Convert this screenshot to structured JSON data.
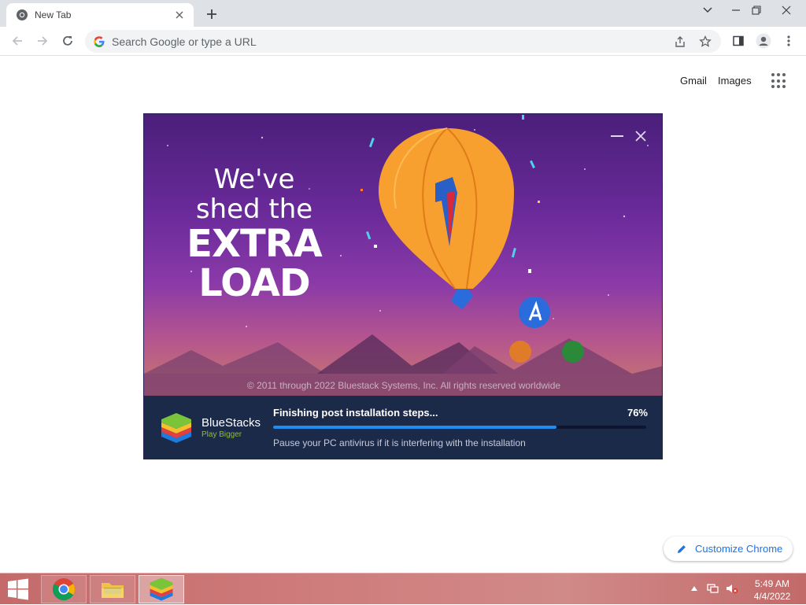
{
  "browser": {
    "tab_title": "New Tab",
    "omnibox_placeholder": "Search Google or type a URL"
  },
  "ntp": {
    "gmail_link": "Gmail",
    "images_link": "Images",
    "customize_label": "Customize Chrome"
  },
  "installer": {
    "headline_line1": "We've",
    "headline_line2": "shed the",
    "headline_line3": "EXTRA",
    "headline_line4": "LOAD",
    "copyright": "© 2011 through 2022 Bluestack Systems, Inc. All rights reserved worldwide",
    "brand_name": "BlueStacks",
    "brand_tagline": "Play Bigger",
    "step_text": "Finishing post installation steps...",
    "progress_label": "76%",
    "progress_fraction": 0.76,
    "hint_text": "Pause your PC antivirus if it is interfering with the installation"
  },
  "taskbar": {
    "time": "5:49 AM",
    "date": "4/4/2022",
    "apps": [
      "chrome",
      "file-explorer",
      "bluestacks"
    ]
  },
  "colors": {
    "accent": "#1a73e8",
    "progress": "#1e8df0",
    "installer_bar": "#1c2a4a"
  }
}
